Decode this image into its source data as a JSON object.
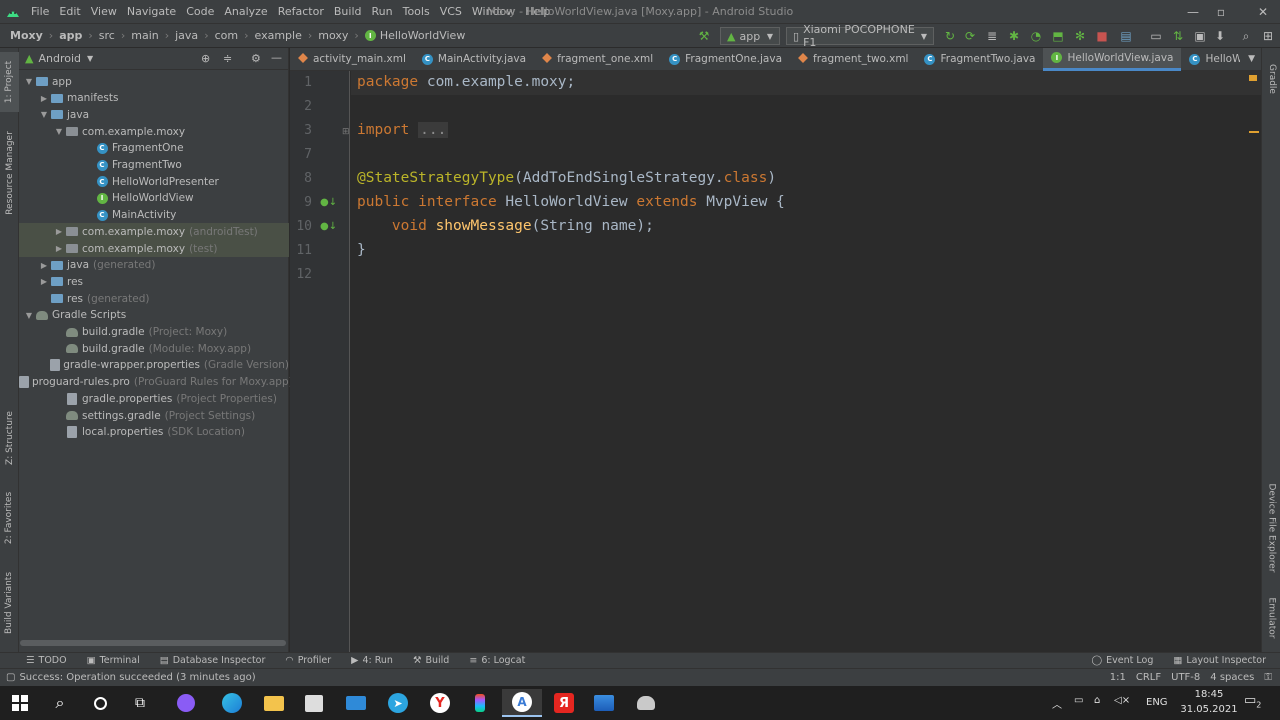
{
  "menubar": {
    "items": [
      "File",
      "Edit",
      "View",
      "Navigate",
      "Code",
      "Analyze",
      "Refactor",
      "Build",
      "Run",
      "Tools",
      "VCS",
      "Window",
      "Help"
    ],
    "title": "Moxy - HelloWorldView.java [Moxy.app] - Android Studio"
  },
  "navbar": {
    "crumbs": [
      "Moxy",
      "app",
      "src",
      "main",
      "java",
      "com",
      "example",
      "moxy",
      "HelloWorldView"
    ],
    "run_config": "app",
    "device": "Xiaomi POCOPHONE F1"
  },
  "leftstripe": {
    "project": "1: Project",
    "resource": "Resource Manager",
    "structure": "Z: Structure",
    "favorites": "2: Favorites",
    "variants": "Build Variants"
  },
  "rightstripe": {
    "gradle": "Gradle",
    "device_explorer": "Device File Explorer",
    "emulator": "Emulator"
  },
  "project": {
    "view_mode": "Android",
    "tree": [
      {
        "label": "app",
        "hint": "",
        "indent": 0,
        "arrow": "▼",
        "icon": "folder"
      },
      {
        "label": "manifests",
        "hint": "",
        "indent": 1,
        "arrow": "▶",
        "icon": "folder"
      },
      {
        "label": "java",
        "hint": "",
        "indent": 1,
        "arrow": "▼",
        "icon": "folder"
      },
      {
        "label": "com.example.moxy",
        "hint": "",
        "indent": 2,
        "arrow": "▼",
        "icon": "package"
      },
      {
        "label": "FragmentOne",
        "hint": "",
        "indent": 4,
        "arrow": "",
        "icon": "class"
      },
      {
        "label": "FragmentTwo",
        "hint": "",
        "indent": 4,
        "arrow": "",
        "icon": "class"
      },
      {
        "label": "HelloWorldPresenter",
        "hint": "",
        "indent": 4,
        "arrow": "",
        "icon": "class"
      },
      {
        "label": "HelloWorldView",
        "hint": "",
        "indent": 4,
        "arrow": "",
        "icon": "interface"
      },
      {
        "label": "MainActivity",
        "hint": "",
        "indent": 4,
        "arrow": "",
        "icon": "class"
      },
      {
        "label": "com.example.moxy",
        "hint": "(androidTest)",
        "indent": 2,
        "arrow": "▶",
        "icon": "package"
      },
      {
        "label": "com.example.moxy",
        "hint": "(test)",
        "indent": 2,
        "arrow": "▶",
        "icon": "package"
      },
      {
        "label": "java",
        "hint": "(generated)",
        "indent": 1,
        "arrow": "▶",
        "icon": "folder"
      },
      {
        "label": "res",
        "hint": "",
        "indent": 1,
        "arrow": "▶",
        "icon": "folder"
      },
      {
        "label": "res",
        "hint": "(generated)",
        "indent": 1,
        "arrow": "",
        "icon": "folder"
      },
      {
        "label": "Gradle Scripts",
        "hint": "",
        "indent": 0,
        "arrow": "▼",
        "icon": "gradle"
      },
      {
        "label": "build.gradle",
        "hint": "(Project: Moxy)",
        "indent": 2,
        "arrow": "",
        "icon": "gradle"
      },
      {
        "label": "build.gradle",
        "hint": "(Module: Moxy.app)",
        "indent": 2,
        "arrow": "",
        "icon": "gradle"
      },
      {
        "label": "gradle-wrapper.properties",
        "hint": "(Gradle Version)",
        "indent": 2,
        "arrow": "",
        "icon": "file"
      },
      {
        "label": "proguard-rules.pro",
        "hint": "(ProGuard Rules for Moxy.app)",
        "indent": 2,
        "arrow": "",
        "icon": "file"
      },
      {
        "label": "gradle.properties",
        "hint": "(Project Properties)",
        "indent": 2,
        "arrow": "",
        "icon": "file"
      },
      {
        "label": "settings.gradle",
        "hint": "(Project Settings)",
        "indent": 2,
        "arrow": "",
        "icon": "gradle"
      },
      {
        "label": "local.properties",
        "hint": "(SDK Location)",
        "indent": 2,
        "arrow": "",
        "icon": "file"
      }
    ]
  },
  "tabs": [
    {
      "label": "activity_main.xml",
      "icon": "xml"
    },
    {
      "label": "MainActivity.java",
      "icon": "class"
    },
    {
      "label": "fragment_one.xml",
      "icon": "xml"
    },
    {
      "label": "FragmentOne.java",
      "icon": "class"
    },
    {
      "label": "fragment_two.xml",
      "icon": "xml"
    },
    {
      "label": "FragmentTwo.java",
      "icon": "class"
    },
    {
      "label": "HelloWorldView.java",
      "icon": "interface"
    },
    {
      "label": "HelloWorldPres",
      "icon": "class"
    }
  ],
  "editor": {
    "line_numbers": [
      "1",
      "2",
      "3",
      "7",
      "8",
      "9",
      "10",
      "11",
      "12"
    ],
    "l1_kw": "package",
    "l1_rest": " com.example.moxy;",
    "l3_kw": "import",
    "l3_fold": "...",
    "l8_ann": "@StateStrategyType",
    "l8_mid": "(AddToEndSingleStrategy.",
    "l8_kw": "class",
    "l8_end": ")",
    "l9_kw1": "public interface",
    "l9_name": " HelloWorldView ",
    "l9_kw2": "extends",
    "l9_end": " MvpView {",
    "l10_kw": "void",
    "l10_fn": "showMessage",
    "l10_end": "(String name);",
    "l11": "}"
  },
  "bottombar": {
    "todo": "TODO",
    "terminal": "Terminal",
    "db": "Database Inspector",
    "profiler": "Profiler",
    "run": "4: Run",
    "build": "Build",
    "logcat": "6: Logcat",
    "eventlog": "Event Log",
    "layout": "Layout Inspector"
  },
  "status": {
    "message": "Success: Operation succeeded (3 minutes ago)",
    "position": "1:1",
    "line_sep": "CRLF",
    "encoding": "UTF-8",
    "indent": "4 spaces"
  },
  "taskbar": {
    "lang": "ENG",
    "time": "18:45",
    "date": "31.05.2021",
    "notif": "2"
  }
}
